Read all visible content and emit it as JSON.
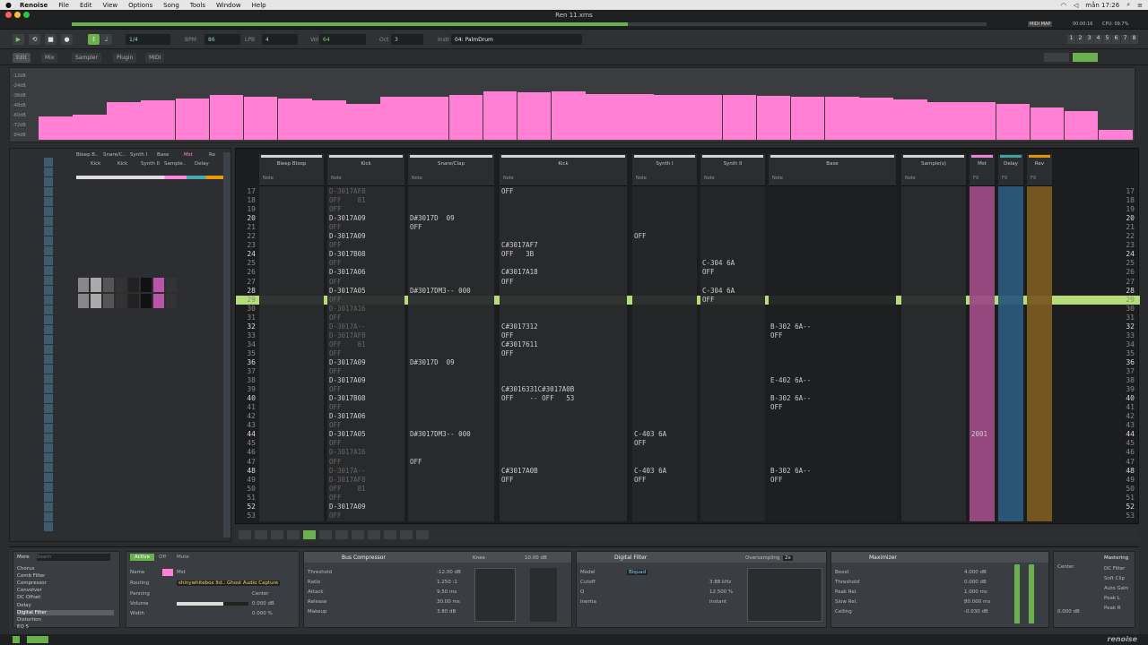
{
  "menubar": {
    "app": "Renoise",
    "items": [
      "File",
      "Edit",
      "View",
      "Options",
      "Song",
      "Tools",
      "Window",
      "Help"
    ],
    "clock": "mån 17:26"
  },
  "window": {
    "title": "Ren 11.xrns"
  },
  "transport": {
    "lpb_label": "LPB",
    "bpm_label": "BPM",
    "bpm": "86",
    "lpb": "4",
    "vol_label": "Vol",
    "vol": "64",
    "oct_label": "Oct",
    "oct": "3",
    "instr_label": "Instr",
    "instrument": "04: PalmDrum",
    "pattern_step": "1/4",
    "midi_map": "MIDI MAP",
    "time": "00:00:16",
    "cpu": "CPU: 09.7%",
    "track_numbers": [
      "1",
      "2",
      "3",
      "4",
      "5",
      "6",
      "7",
      "8"
    ]
  },
  "tabs": [
    "Edit",
    "Mix",
    "Sampler",
    "Plugin",
    "MIDI"
  ],
  "spectrum": {
    "db_labels": [
      "-12dB",
      "-24dB",
      "-36dB",
      "-48dB",
      "-60dB",
      "-72dB",
      "-84dB"
    ],
    "levels": [
      0.32,
      0.35,
      0.52,
      0.55,
      0.57,
      0.62,
      0.6,
      0.57,
      0.55,
      0.5,
      0.6,
      0.6,
      0.62,
      0.68,
      0.66,
      0.68,
      0.64,
      0.64,
      0.62,
      0.62,
      0.62,
      0.61,
      0.6,
      0.6,
      0.59,
      0.56,
      0.53,
      0.52,
      0.5,
      0.45,
      0.4,
      0.14
    ]
  },
  "mixer": {
    "tracks": [
      "Bleep B..",
      "Snare/C..",
      "Synth I",
      "Base",
      "Mst",
      "Re"
    ],
    "tracks_row2": [
      "Kick",
      "Kick",
      "Synth II",
      "Sample..",
      "Delay"
    ]
  },
  "pattern": {
    "current_row": "29",
    "columns": [
      {
        "name": "Bleep Bloop",
        "sub": "Note"
      },
      {
        "name": "Kick",
        "sub": "Note"
      },
      {
        "name": "Snare/Clap",
        "sub": "Note"
      },
      {
        "name": "Kick",
        "sub": "Note"
      },
      {
        "name": "Synth I",
        "sub": "Note"
      },
      {
        "name": "Synth II",
        "sub": "Note"
      },
      {
        "name": "Base",
        "sub": "Note"
      },
      {
        "name": "Sample(s)",
        "sub": "Note"
      },
      {
        "name": "Mst",
        "sub": "FX"
      },
      {
        "name": "Delay",
        "sub": "FX"
      },
      {
        "name": "Rev",
        "sub": "FX"
      }
    ],
    "rows": [
      "17",
      "18",
      "19",
      "20",
      "21",
      "22",
      "23",
      "24",
      "25",
      "26",
      "27",
      "28",
      "29",
      "30",
      "31",
      "32",
      "33",
      "34",
      "35",
      "36",
      "37",
      "38",
      "39",
      "40",
      "41",
      "42",
      "43",
      "44",
      "45",
      "46",
      "47",
      "48",
      "49",
      "50",
      "51",
      "52",
      "53"
    ],
    "kick": [
      "D-3017AF8",
      "OFF    81",
      "OFF",
      "D-3017A09",
      "OFF",
      "D-3017A09",
      "OFF",
      "D-3017B08",
      "OFF",
      "D-3017A06",
      "OFF",
      "D-3017A05",
      "OFF",
      "D-3017A16",
      "OFF",
      "D-3017A--",
      "D-3017AF8",
      "OFF    81",
      "OFF",
      "D-3017A09",
      "OFF",
      "D-3017A09",
      "OFF",
      "D-3017B08",
      "OFF",
      "D-3017A06",
      "OFF",
      "D-3017A05",
      "OFF",
      "D-3017A16",
      "OFF",
      "D-3017A--",
      "D-3017AF8",
      "OFF    81",
      "OFF",
      "D-3017A09",
      "OFF"
    ],
    "snare": {
      "20": "D#3017D  09",
      "21": "OFF",
      "28": "D#3017DM3-- 000",
      "36": "D#3017D  09",
      "44": "D#3017DM3-- 000",
      "47": "OFF"
    },
    "kick2": {
      "17": "OFF",
      "23": "C#3017AF7",
      "24": "OFF   3B",
      "26": "C#3017A18",
      "27": "OFF",
      "32": "C#3017312",
      "33": "OFF",
      "34": "C#3017611",
      "35": "OFF",
      "39": "C#3016331C#3017A0B",
      "40": "OFF    -- OFF   53",
      "48": "C#3017A0B",
      "49": "OFF"
    },
    "synth1": {
      "22": "OFF",
      "44": "C-403 6A",
      "45": "OFF",
      "48": "C-403 6A",
      "49": "OFF"
    },
    "synth2": {
      "25": "C-304 6A",
      "26": "OFF",
      "28": "C-304 6A",
      "29": "OFF"
    },
    "base": {
      "32": "B-302 6A--",
      "33": "OFF",
      "38": "E-402 6A--",
      "40": "B-302 6A--",
      "41": "OFF",
      "48": "B-302 6A--",
      "49": "OFF"
    },
    "mst": {
      "44": "2001"
    }
  },
  "dsp": {
    "chain": [
      "Chorus",
      "Comb Filter",
      "Compressor",
      "Convolver",
      "DC Offset",
      "Delay",
      "Digital Filter",
      "Distortion",
      "EQ 5"
    ],
    "selected_chain": "Digital Filter",
    "search_label": "More",
    "search_placeholder": "Search",
    "track": {
      "active": "Active",
      "off": "Off",
      "mute": "Mute",
      "name_label": "Name",
      "name": "Mst",
      "routing_label": "Routing",
      "routing": "shinywhitebox Itd.: Ghost Audio Capture",
      "panning_label": "Panning",
      "panning": "Center",
      "volume_label": "Volume",
      "volume": "0.000 dB",
      "width_label": "Width",
      "width": "0.000 %"
    },
    "compressor": {
      "title": "Bus Compressor",
      "threshold": "-12.00 dB",
      "ratio": "1.250 :1",
      "attack": "9.50 ms",
      "release": "30.00 ms",
      "makeup": "3.80 dB",
      "knee": "10.00 dB",
      "knee_label": "Knee",
      "labels": [
        "Threshold",
        "Ratio",
        "Attack",
        "Release",
        "Makeup"
      ]
    },
    "filter": {
      "title": "Digital Filter",
      "model_label": "Model",
      "model": "Biquad",
      "cutoff_label": "Cutoff",
      "cutoff": "3.88 kHz",
      "q_label": "Q",
      "q": "12.500 %",
      "inertia_label": "Inertia",
      "inertia": "Instant",
      "oversampling_label": "Oversampling",
      "oversampling": "2x"
    },
    "maximizer": {
      "title": "Maximizer",
      "boost_label": "Boost",
      "boost": "4.000 dB",
      "threshold_label": "Threshold",
      "threshold": "0.000 dB",
      "peak_rel_label": "Peak Rel.",
      "peak_rel": "1.000 ms",
      "slow_rel_label": "Slow Rel.",
      "slow_rel": "80.000 ms",
      "ceiling_label": "Ceiling",
      "ceiling": "-0.030 dB"
    },
    "mastering": {
      "title": "Mastering",
      "items": [
        "DC Filter",
        "Soft Clip",
        "Auto Gain",
        "Peak L",
        "Peak R"
      ],
      "center": "Center",
      "db": "0.000 dB"
    }
  }
}
